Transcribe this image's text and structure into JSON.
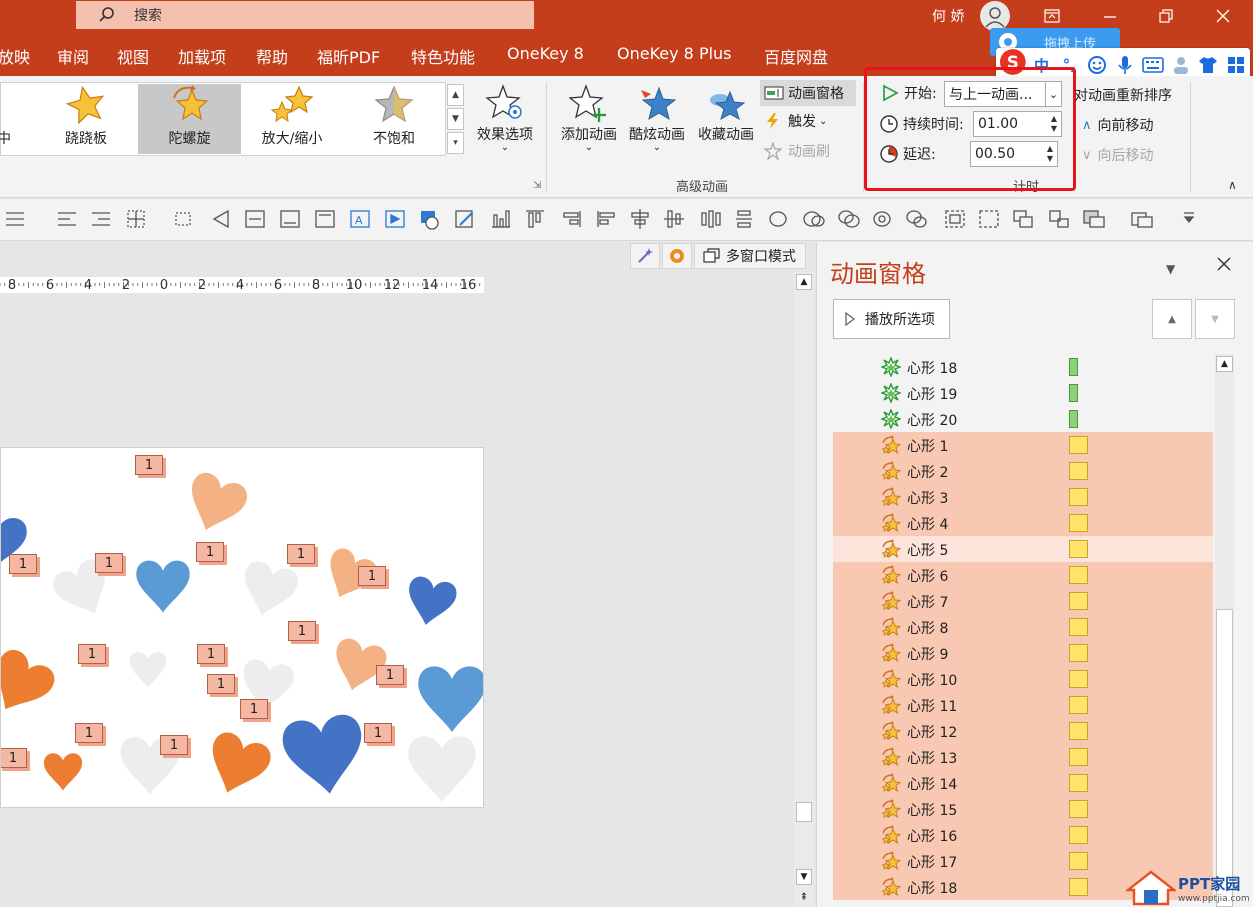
{
  "titlebar": {
    "search_placeholder": "搜索",
    "user_name": "何 娇"
  },
  "menu": {
    "items": [
      "放映",
      "审阅",
      "视图",
      "加载项",
      "帮助",
      "福昕PDF",
      "特色功能",
      "OneKey 8",
      "OneKey 8 Plus",
      "百度网盘"
    ]
  },
  "overlay": {
    "baidu_upload": "拖拽上传",
    "ime_label": "中"
  },
  "ribbon": {
    "gallery": [
      {
        "label": "中",
        "icon": "star-center-icon"
      },
      {
        "label": "跷跷板",
        "icon": "seesaw-star-icon"
      },
      {
        "label": "陀螺旋",
        "icon": "spin-star-icon",
        "selected": true
      },
      {
        "label": "放大/缩小",
        "icon": "grow-shrink-star-icon"
      },
      {
        "label": "不饱和",
        "icon": "desaturate-star-icon"
      }
    ],
    "effect_options": "效果选项",
    "add_animation": "添加动画",
    "cool_animation": "酷炫动画",
    "favorite_animation": "收藏动画",
    "animation_pane": "动画窗格",
    "trigger": "触发",
    "animation_painter": "动画刷",
    "advanced_group_label": "高级动画",
    "timing": {
      "start_label": "开始:",
      "start_value": "与上一动画...",
      "duration_label": "持续时间:",
      "duration_value": "01.00",
      "delay_label": "延迟:",
      "delay_value": "00.50",
      "group_label": "计时"
    },
    "reorder_label": "对动画重新排序",
    "move_earlier": "向前移动",
    "move_later": "向后移动"
  },
  "editor": {
    "multiwindow": "多窗口模式",
    "ruler_ticks": [
      "8",
      "6",
      "4",
      "2",
      "0",
      "2",
      "4",
      "6",
      "8",
      "10",
      "12",
      "14",
      "16"
    ],
    "tag_label": "1"
  },
  "pane": {
    "title": "动画窗格",
    "play_selected": "播放所选项",
    "rows": [
      {
        "label": "心形 18",
        "type": "entrance",
        "state": "normal"
      },
      {
        "label": "心形 19",
        "type": "entrance",
        "state": "normal"
      },
      {
        "label": "心形 20",
        "type": "entrance",
        "state": "normal"
      },
      {
        "label": "心形 1",
        "type": "emphasis",
        "state": "selected"
      },
      {
        "label": "心形 2",
        "type": "emphasis",
        "state": "selected"
      },
      {
        "label": "心形 3",
        "type": "emphasis",
        "state": "selected"
      },
      {
        "label": "心形 4",
        "type": "emphasis",
        "state": "selected"
      },
      {
        "label": "心形 5",
        "type": "emphasis",
        "state": "current"
      },
      {
        "label": "心形 6",
        "type": "emphasis",
        "state": "selected"
      },
      {
        "label": "心形 7",
        "type": "emphasis",
        "state": "selected"
      },
      {
        "label": "心形 8",
        "type": "emphasis",
        "state": "selected"
      },
      {
        "label": "心形 9",
        "type": "emphasis",
        "state": "selected"
      },
      {
        "label": "心形 10",
        "type": "emphasis",
        "state": "selected"
      },
      {
        "label": "心形 11",
        "type": "emphasis",
        "state": "selected"
      },
      {
        "label": "心形 12",
        "type": "emphasis",
        "state": "selected"
      },
      {
        "label": "心形 13",
        "type": "emphasis",
        "state": "selected"
      },
      {
        "label": "心形 14",
        "type": "emphasis",
        "state": "selected"
      },
      {
        "label": "心形 15",
        "type": "emphasis",
        "state": "selected"
      },
      {
        "label": "心形 16",
        "type": "emphasis",
        "state": "selected"
      },
      {
        "label": "心形 17",
        "type": "emphasis",
        "state": "selected"
      },
      {
        "label": "心形 18",
        "type": "emphasis",
        "state": "selected"
      }
    ]
  },
  "watermark": {
    "brand": "PPT家园",
    "url": "www.pptjia.com"
  },
  "colors": {
    "accent": "#c43e1c",
    "selected_row": "#f8c8b2",
    "entrance_bar": "#8fd07c",
    "emphasis_bar": "#ffe36b",
    "highlight_box": "#e8141a"
  }
}
